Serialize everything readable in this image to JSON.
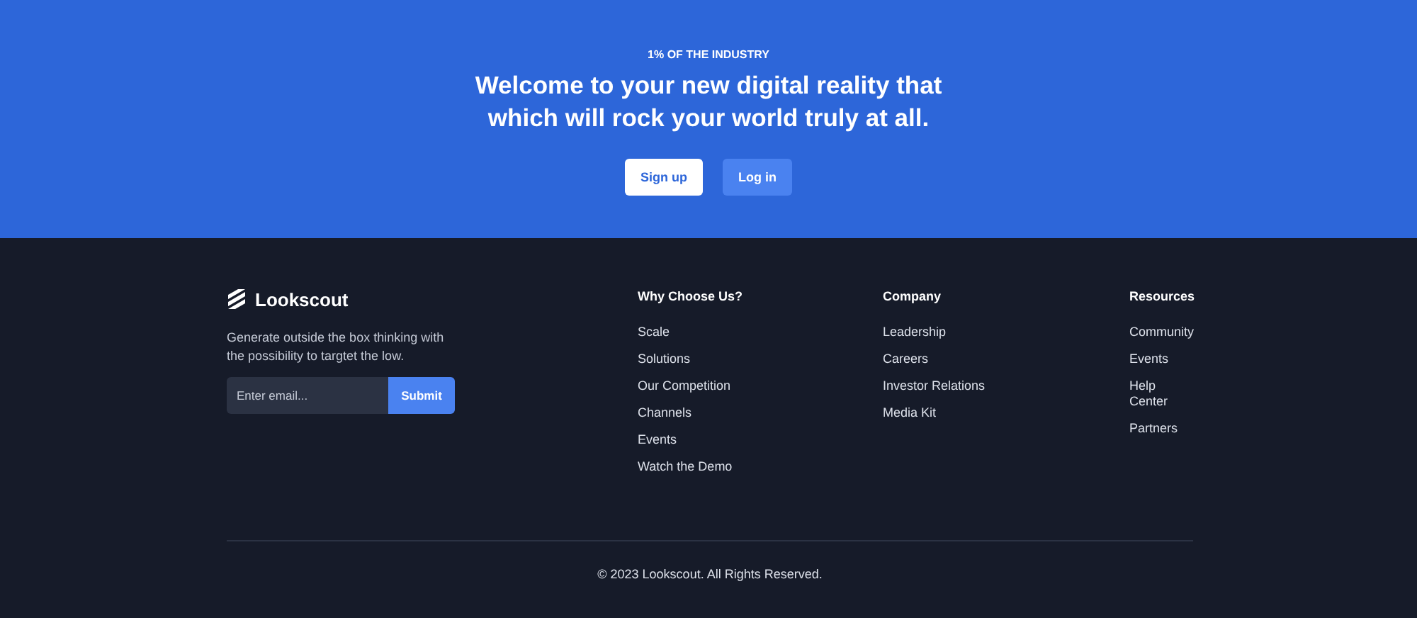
{
  "hero": {
    "eyebrow": "1% OF THE INDUSTRY",
    "headline": "Welcome to your new digital reality that which will rock your world truly at all.",
    "buttons": [
      {
        "label": "Sign up",
        "kind": "primary"
      },
      {
        "label": "Log in",
        "kind": "secondary"
      }
    ]
  },
  "footer": {
    "brand": "Lookscout",
    "tagline": "Generate outside the box thinking with the possibility to targtet the low.",
    "email": {
      "placeholder": "Enter email...",
      "button": "Submit"
    },
    "columns": [
      {
        "title": "Why Choose Us?",
        "links": [
          "Scale",
          "Solutions",
          "Our Competition",
          "Channels",
          "Events",
          "Watch the Demo"
        ]
      },
      {
        "title": "Company",
        "links": [
          "Leadership",
          "Careers",
          "Investor Relations",
          "Media Kit"
        ]
      },
      {
        "title": "Resources",
        "links": [
          "Community",
          "Events",
          "Help Center",
          "Partners"
        ]
      }
    ],
    "copyright": "© 2023 Lookscout. All Rights Reserved."
  }
}
